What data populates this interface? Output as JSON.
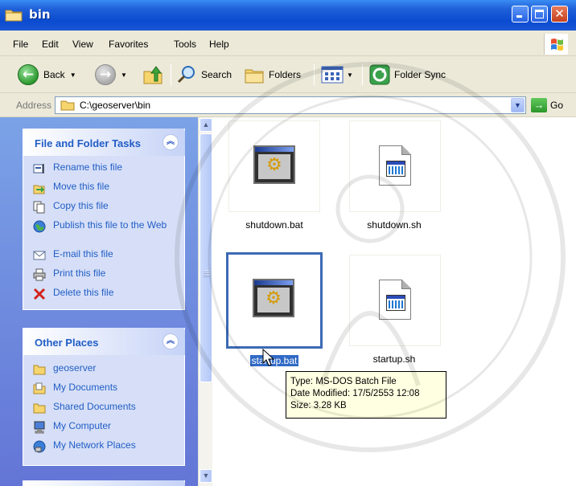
{
  "window": {
    "title": "bin"
  },
  "menu": [
    "File",
    "Edit",
    "View",
    "Favorites",
    "Tools",
    "Help"
  ],
  "toolbar": {
    "back_label": "Back",
    "search_label": "Search",
    "folders_label": "Folders",
    "sync_label": "Folder Sync"
  },
  "address": {
    "label": "Address",
    "value": "C:\\geoserver\\bin",
    "go_label": "Go"
  },
  "file_tasks": {
    "title": "File and Folder Tasks",
    "items": [
      {
        "label": "Rename this file",
        "icon": "rename-icon"
      },
      {
        "label": "Move this file",
        "icon": "move-icon"
      },
      {
        "label": "Copy this file",
        "icon": "copy-icon"
      },
      {
        "label": "Publish this file to the Web",
        "icon": "publish-web-icon"
      },
      {
        "label": "E-mail this file",
        "icon": "email-icon"
      },
      {
        "label": "Print this file",
        "icon": "print-icon"
      },
      {
        "label": "Delete this file",
        "icon": "delete-icon"
      }
    ]
  },
  "other_places": {
    "title": "Other Places",
    "items": [
      {
        "label": "geoserver",
        "icon": "folder-icon"
      },
      {
        "label": "My Documents",
        "icon": "my-documents-icon"
      },
      {
        "label": "Shared Documents",
        "icon": "folder-icon"
      },
      {
        "label": "My Computer",
        "icon": "my-computer-icon"
      },
      {
        "label": "My Network Places",
        "icon": "network-places-icon"
      }
    ]
  },
  "files": [
    {
      "name": "shutdown.bat",
      "type": "bat",
      "selected": false
    },
    {
      "name": "shutdown.sh",
      "type": "sh",
      "selected": false
    },
    {
      "name": "startup.bat",
      "type": "bat",
      "selected": true
    },
    {
      "name": "startup.sh",
      "type": "sh",
      "selected": false
    }
  ],
  "tooltip": {
    "type": "Type: MS-DOS Batch File",
    "modified": "Date Modified: 17/5/2553 12:08",
    "size": "Size: 3.28 KB"
  },
  "colors": {
    "titlebar": "#0a4bd0",
    "taskpane": "#6f8fe0",
    "link": "#215dc6",
    "selection": "#316ac5",
    "tooltip_bg": "#ffffe1"
  }
}
